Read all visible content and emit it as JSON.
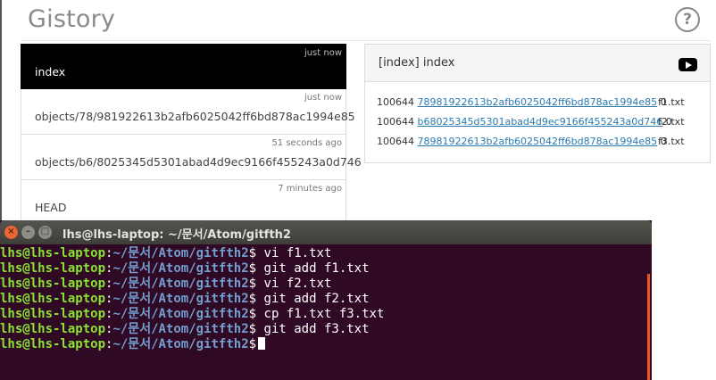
{
  "app": {
    "title": "Gistory",
    "help_glyph": "?"
  },
  "history": [
    {
      "time": "just now",
      "label": "index",
      "active": true
    },
    {
      "time": "just now",
      "label": "objects/78/981922613b2afb6025042ff6bd878ac1994e85",
      "active": false
    },
    {
      "time": "51 seconds ago",
      "label": "objects/b6/8025345d5301abad4d9ec9166f455243a0d746",
      "active": false
    },
    {
      "time": "7 minutes ago",
      "label": "HEAD",
      "active": false
    }
  ],
  "detail": {
    "title": "[index] index",
    "entries": [
      {
        "mode": "100644",
        "hash": "78981922613b2afb6025042ff6bd878ac1994e85",
        "stage": "0",
        "file": "f1.txt"
      },
      {
        "mode": "100644",
        "hash": "b68025345d5301abad4d9ec9166f455243a0d746",
        "stage": "0",
        "file": "f2.txt"
      },
      {
        "mode": "100644",
        "hash": "78981922613b2afb6025042ff6bd878ac1994e85",
        "stage": "0",
        "file": "f3.txt"
      }
    ]
  },
  "terminal": {
    "title": "lhs@lhs-laptop: ~/문서/Atom/gitfth2",
    "prompt_user": "lhs@lhs-laptop",
    "prompt_path": "~/문서/Atom/gitfth2",
    "prompt_sep": ":",
    "prompt_dollar": "$",
    "commands": [
      "vi f1.txt",
      "git add f1.txt",
      "vi f2.txt",
      "git add f2.txt",
      "cp f1.txt f3.txt",
      "git add f3.txt"
    ],
    "current_command": ""
  },
  "colors": {
    "terminal_bg": "#300a24",
    "prompt_user": "#8ae234",
    "prompt_path": "#729fcf",
    "link": "#2a7ab0",
    "active_item": "#000000"
  }
}
